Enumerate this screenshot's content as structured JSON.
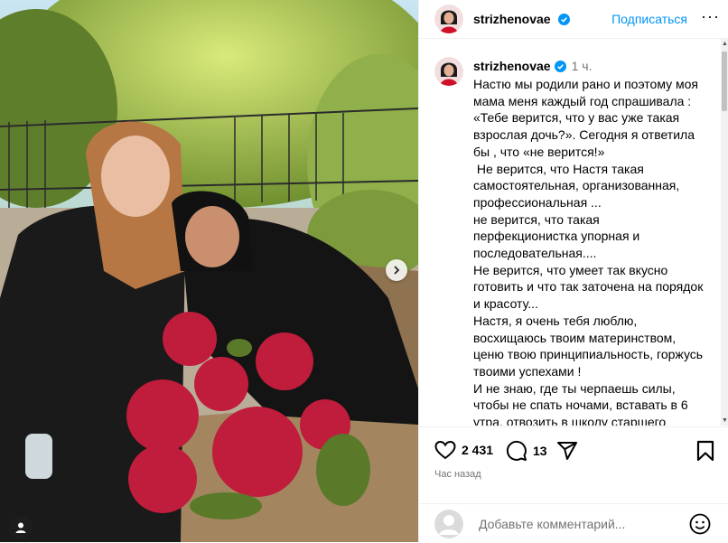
{
  "post": {
    "author": "strizhenovae",
    "follow_label": "Подписаться",
    "more_label": "···",
    "time_ago": "1 ч.",
    "caption": "Настю мы родили рано и поэтому моя мама меня каждый год спрашивала : «Тебе верится, что у вас уже такая взрослая дочь?». Сегодня я ответила бы , что «не верится!»\n Не верится, что Настя такая самостоятельная, организованная, профессиональная ...\nне верится, что такая перфекционистка упорная и последовательная....\nНе верится, что умеет так вкусно готовить и что так заточена на порядок и красоту...\nНастя, я очень тебя люблю, восхищаюсь твоим материнством, ценю твою принципиальность, горжусь твоими успехами !\nИ не знаю, где ты черпаешь силы, чтобы не спать ночами, вставать в 6 утра, отвозить в школу старшего",
    "likes": "2 431",
    "comments": "13",
    "posted": "Час назад"
  },
  "comment_box": {
    "placeholder": "Добавьте комментарий..."
  },
  "colors": {
    "accent": "#0095f6",
    "verified": "#0095f6",
    "muted": "#737373"
  }
}
